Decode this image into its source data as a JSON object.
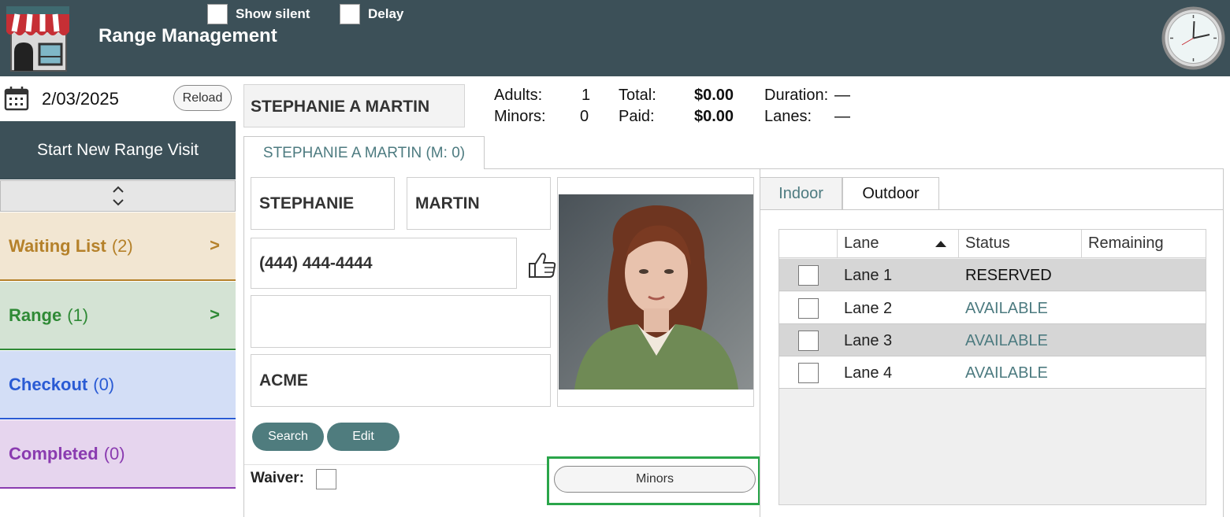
{
  "header": {
    "title": "Range Management",
    "show_silent_label": "Show silent",
    "delay_label": "Delay",
    "bg_color": "#3c5058"
  },
  "sidebar": {
    "date": "2/03/2025",
    "reload_label": "Reload",
    "start_visit_label": "Start New Range Visit",
    "items": [
      {
        "label": "Waiting List",
        "count": "(2)",
        "color": "#b5812a",
        "bg": "#f2e6d2",
        "chevron": ">"
      },
      {
        "label": "Range",
        "count": "(1)",
        "color": "#2f8a36",
        "bg": "#d4e3d4",
        "chevron": ">"
      },
      {
        "label": "Checkout",
        "count": "(0)",
        "color": "#2a5bd4",
        "bg": "#d3def6"
      },
      {
        "label": "Completed",
        "count": "(0)",
        "color": "#8a3bb0",
        "bg": "#e6d5ee"
      }
    ]
  },
  "summary": {
    "customer_name": "STEPHANIE A MARTIN",
    "adults_label": "Adults:",
    "adults_value": "1",
    "minors_label": "Minors:",
    "minors_value": "0",
    "total_label": "Total:",
    "total_value": "$0.00",
    "paid_label": "Paid:",
    "paid_value": "$0.00",
    "duration_label": "Duration:",
    "duration_value": "—",
    "lanes_label": "Lanes:",
    "lanes_value": "—"
  },
  "customer": {
    "tab_label": "STEPHANIE A MARTIN (M: 0)",
    "first_name": "STEPHANIE",
    "last_name": "MARTIN",
    "phone": "(444) 444-4444",
    "email": "",
    "company": "ACME",
    "search_label": "Search",
    "edit_label": "Edit",
    "waiver_label": "Waiver:",
    "minors_button_label": "Minors"
  },
  "lanes": {
    "tabs": [
      "Indoor",
      "Outdoor"
    ],
    "columns": [
      "Lane",
      "Status",
      "Remaining"
    ],
    "rows": [
      {
        "lane": "Lane 1",
        "status": "RESERVED",
        "remaining": "",
        "status_color": "#111111",
        "bg": "#d6d6d6"
      },
      {
        "lane": "Lane 2",
        "status": "AVAILABLE",
        "remaining": "",
        "status_color": "#4d7b80",
        "bg": "#ffffff"
      },
      {
        "lane": "Lane 3",
        "status": "AVAILABLE",
        "remaining": "",
        "status_color": "#4d7b80",
        "bg": "#d6d6d6"
      },
      {
        "lane": "Lane 4",
        "status": "AVAILABLE",
        "remaining": "",
        "status_color": "#4d7b80",
        "bg": "#ffffff"
      }
    ]
  },
  "colors": {
    "accent_teal": "#4f7c7e",
    "highlight_green": "#2aa54a"
  }
}
